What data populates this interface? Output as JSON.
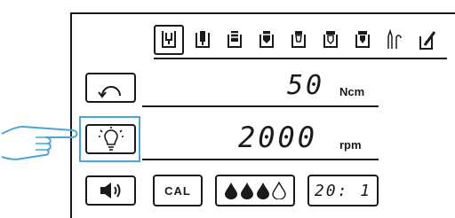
{
  "speed": {
    "value": "2000",
    "unit": "rpm"
  },
  "torque": {
    "value": "50",
    "unit": "Ncm"
  },
  "buttons": {
    "calibrate_label": "CAL",
    "ratio_label": "20: 1"
  },
  "programs": [
    {
      "icon": "program-1-icon",
      "selected": true
    },
    {
      "icon": "program-2-icon"
    },
    {
      "icon": "program-3-icon"
    },
    {
      "icon": "program-4-icon"
    },
    {
      "icon": "program-5-icon"
    },
    {
      "icon": "program-6-icon"
    },
    {
      "icon": "program-7-icon"
    },
    {
      "icon": "program-8-icon"
    },
    {
      "icon": "program-9-icon"
    }
  ],
  "colors": {
    "highlight": "#4aa6d6",
    "ink": "#1a1a1a"
  }
}
